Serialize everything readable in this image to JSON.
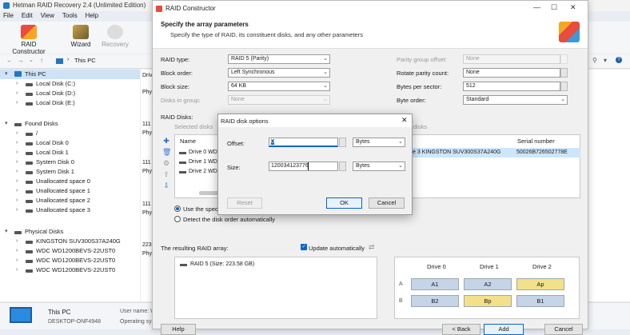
{
  "app": {
    "title": "Hetman RAID Recovery 2.4 (Unlimited Edition)",
    "menu": [
      "File",
      "Edit",
      "View",
      "Tools",
      "Help"
    ],
    "toolbar": {
      "raid_constructor": "RAID Constructor",
      "wizard": "Wizard",
      "recovery": "Recovery"
    },
    "address": "This PC",
    "tree": {
      "this_pc": "This PC",
      "local_disks": [
        "Local Disk (C:)",
        "Local Disk (D:)",
        "Local Disk (E:)"
      ],
      "found_disks": "Found Disks",
      "found_items": [
        "/",
        "Local Disk 0",
        "Local Disk 1",
        "System Disk 0",
        "System Disk 1",
        "Unallocated space 0",
        "Unallocated space 1",
        "Unallocated space 2",
        "Unallocated space 3"
      ],
      "physical_disks": "Physical Disks",
      "physical_items": [
        "KINGSTON SUV300S37A240G",
        "WDC WD1200BEVS-22UST0",
        "WDC WD1200BEVS-22UST0",
        "WDC WD1200BEVS-22UST0"
      ]
    },
    "right_fragments": [
      "Driv",
      "Phy",
      "111",
      "Phy",
      "111",
      "Phy",
      "111",
      "Phy",
      "223",
      "Phy"
    ],
    "status": {
      "name": "This PC",
      "desktop": "DESKTOP-ONF4948",
      "user_label": "User name: W",
      "os_label": "Operating sys"
    }
  },
  "rc": {
    "title": "RAID Constructor",
    "header_title": "Specify the array parameters",
    "header_sub": "Specify the type of RAID, its constituent disks, and any other parameters",
    "raid_type_label": "RAID type:",
    "raid_type": "RAID 5 (Parity)",
    "block_order_label": "Block order:",
    "block_order": "Left Synchronous",
    "block_size_label": "Block size:",
    "block_size": "64 KB",
    "disks_in_group_label": "Disks in group:",
    "disks_in_group": "None",
    "parity_offset_label": "Parity group offset:",
    "parity_offset": "None",
    "rotate_label": "Rotate parity count:",
    "rotate": "None",
    "bytes_sector_label": "Bytes per sector:",
    "bytes_sector": "512",
    "byte_order_label": "Byte order:",
    "byte_order": "Standard",
    "raid_disks_label": "RAID Disks:",
    "selected_disks_label": "Selected disks",
    "right_disks_label": "disks",
    "col_name": "Name",
    "col_serial": "Serial number",
    "disks": [
      "Drive 0 WDC",
      "Drive 1 WDC",
      "Drive 2 WDC"
    ],
    "right_row": "ive 3 KINGSTON SUV300S37A240G",
    "right_serial": "50026B726502778E",
    "radio_specific": "Use the specific",
    "radio_detect": "Detect the disk order automatically",
    "result_label": "The resulting RAID array:",
    "update_auto": "Update automatically",
    "result_item": "RAID 5 (Size: 223.58 GB)",
    "grid_cols": [
      "Drive 0",
      "Drive 1",
      "Drive 2"
    ],
    "grid_rows": [
      "A",
      "B"
    ],
    "grid_a": [
      "A1",
      "A2",
      "Ap"
    ],
    "grid_b": [
      "B2",
      "Bp",
      "B1"
    ],
    "btn_help": "Help",
    "btn_back": "< Back",
    "btn_add": "Add",
    "btn_cancel": "Cancel"
  },
  "modal": {
    "title": "RAID disk options",
    "offset_label": "Offset:",
    "offset_value": "0",
    "offset_unit": "Bytes",
    "size_label": "Size:",
    "size_value": "120034123776",
    "size_unit": "Bytes",
    "reset": "Reset",
    "ok": "OK",
    "cancel": "Cancel"
  },
  "colors": {
    "accent": "#0a66c2",
    "data_block": "#c6d4e8",
    "parity_block": "#f3e08a"
  }
}
